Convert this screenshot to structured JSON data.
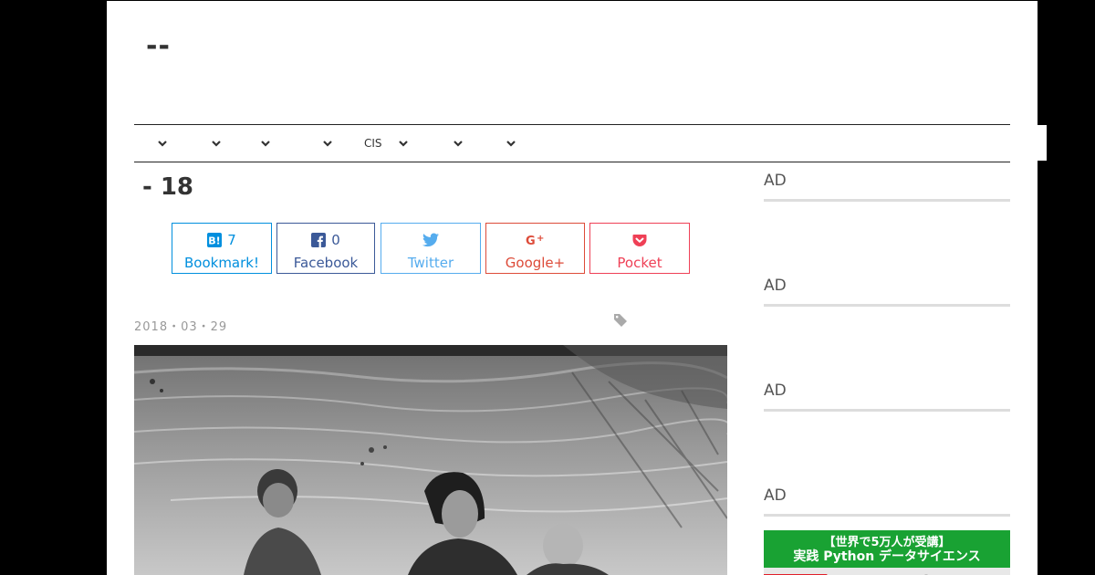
{
  "site": {
    "title": "--"
  },
  "nav": {
    "items": [
      {
        "label": "",
        "icon": "chevron-down-icon"
      },
      {
        "label": "",
        "icon": "chevron-down-icon"
      },
      {
        "label": "",
        "icon": "chevron-down-icon"
      },
      {
        "label": "",
        "icon": "chevron-down-icon"
      },
      {
        "label": "CIS",
        "icon": "chevron-down-icon"
      },
      {
        "label": "",
        "icon": "chevron-down-icon"
      },
      {
        "label": "",
        "icon": "chevron-down-icon"
      }
    ]
  },
  "post": {
    "title": "- 18",
    "date": "2018・03・29",
    "tag_icon": "tag-icon"
  },
  "share": {
    "hatena": {
      "count": "7",
      "label": "Bookmark!",
      "icon": "hatena-bookmark-icon"
    },
    "facebook": {
      "count": "0",
      "label": "Facebook",
      "icon": "facebook-icon"
    },
    "twitter": {
      "label": "Twitter",
      "icon": "twitter-icon"
    },
    "googleplus": {
      "label": "Google+",
      "icon": "google-plus-icon"
    },
    "pocket": {
      "label": "Pocket",
      "icon": "pocket-icon"
    }
  },
  "sidebar": {
    "ads": [
      "AD",
      "AD",
      "AD",
      "AD"
    ],
    "banner": {
      "line1": "【世界で5万人が受講】",
      "line2": "実践 Python データサイエンス"
    }
  },
  "colors": {
    "hatena": "#008fde",
    "facebook": "#3b5998",
    "twitter": "#55acee",
    "googleplus": "#dd4b39",
    "pocket": "#ef4056",
    "banner_green": "#19a233"
  }
}
